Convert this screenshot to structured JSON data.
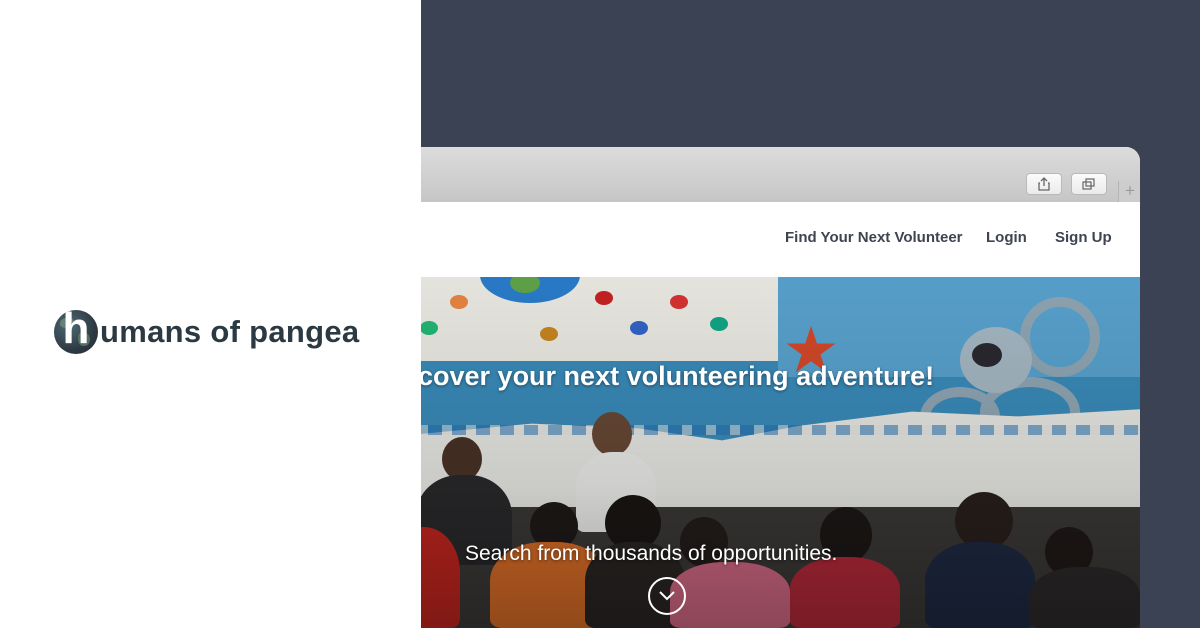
{
  "brand": {
    "logo_letter": "h",
    "name": "umans of pangea",
    "text_color": "#2b3a42"
  },
  "colors": {
    "background": "#3a4253",
    "panel": "#ffffff",
    "browser_chrome": "#d2d2d2",
    "nav_text": "#3e4550"
  },
  "browser": {
    "toolbar": {
      "share_icon": "share-icon",
      "tabs_icon": "tabs-overview-icon",
      "new_tab_glyph": "+"
    }
  },
  "nav": {
    "find": "Find Your Next Volunteer",
    "login": "Login",
    "signup": "Sign Up"
  },
  "hero": {
    "title": "cover your next volunteering adventure!",
    "subtitle": "Search from thousands of opportunities.",
    "scroll_icon": "chevron-down-icon"
  }
}
